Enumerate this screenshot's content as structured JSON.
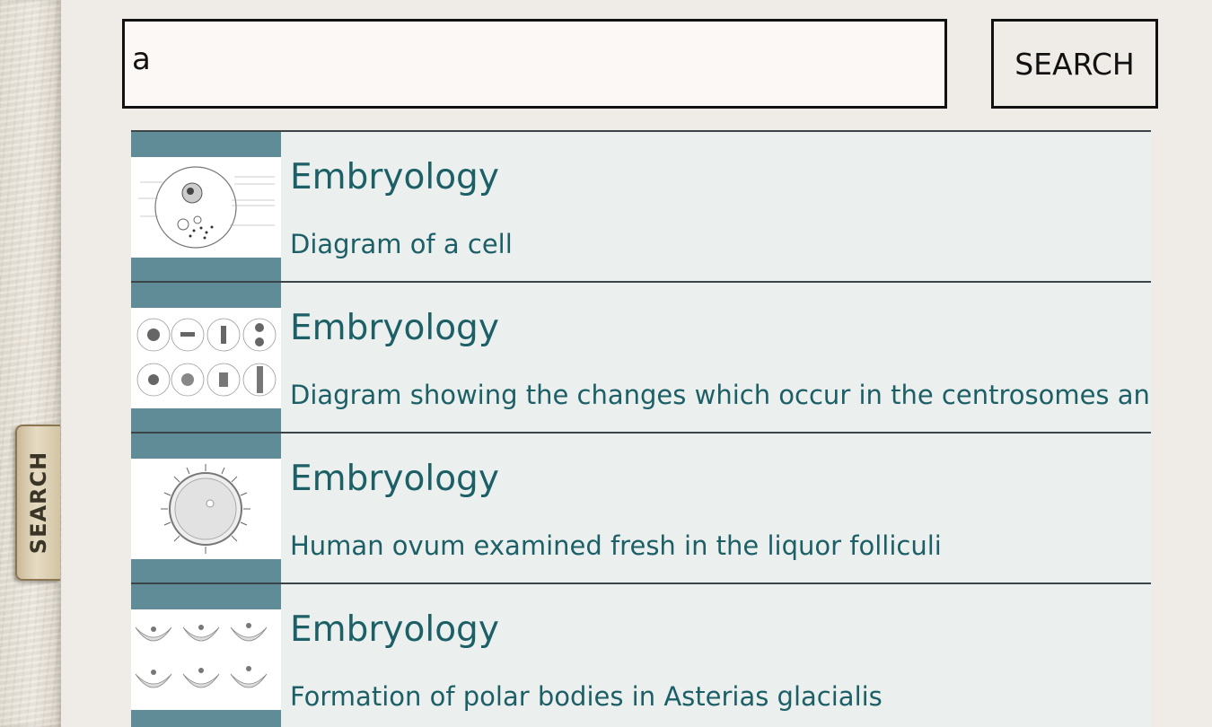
{
  "search": {
    "query": "a",
    "button_label": "SEARCH"
  },
  "side_tab": {
    "label": "SEARCH"
  },
  "results": [
    {
      "title": "Embryology",
      "description": "Diagram of a cell",
      "thumbnail": "cell-diagram-image"
    },
    {
      "title": "Embryology",
      "description": "Diagram showing the changes which occur in the centrosomes and nucleus of a cell",
      "thumbnail": "centrosome-changes-image"
    },
    {
      "title": "Embryology",
      "description": "Human ovum examined fresh in the liquor folliculi",
      "thumbnail": "human-ovum-image"
    },
    {
      "title": "Embryology",
      "description": "Formation of polar bodies in Asterias glacialis",
      "thumbnail": "polar-bodies-image"
    }
  ],
  "colors": {
    "accent": "#5f8c96",
    "text": "#1c5f67",
    "row_bg": "#ebefed",
    "page_bg": "#efebe6"
  }
}
